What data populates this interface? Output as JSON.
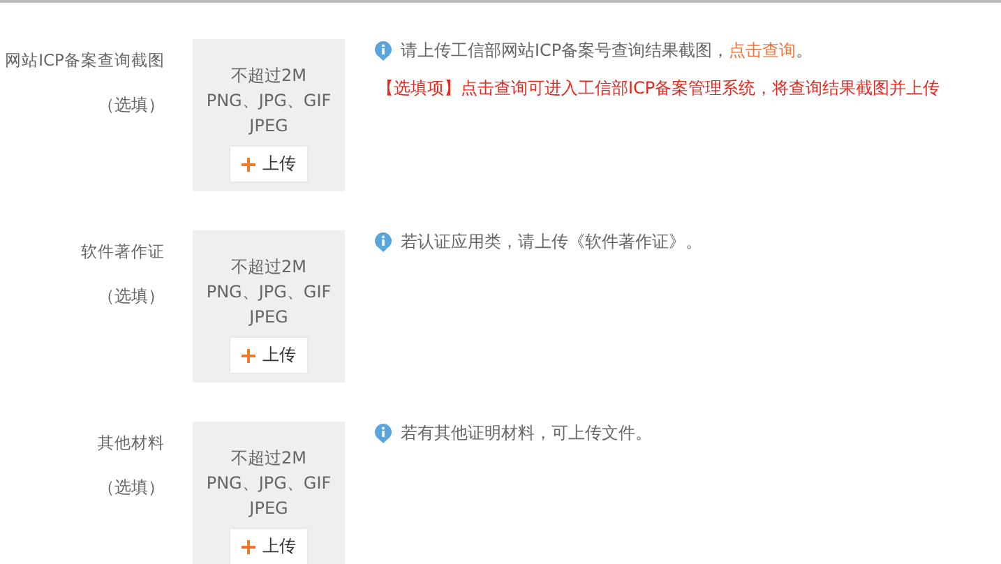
{
  "rows": [
    {
      "label": "网站ICP备案查询截图",
      "optional": "（选填）",
      "limits": [
        "不超过2M",
        "PNG、JPG、GIF",
        "JPEG"
      ],
      "upload": "上传",
      "hint": "请上传工信部网站ICP备案号查询结果截图，",
      "link": "点击查询",
      "suffix": "。",
      "note": "【选填项】点击查询可进入工信部ICP备案管理系统，将查询结果截图并上传"
    },
    {
      "label": "软件著作证",
      "optional": "（选填）",
      "limits": [
        "不超过2M",
        "PNG、JPG、GIF",
        "JPEG"
      ],
      "upload": "上传",
      "hint": "若认证应用类，请上传《软件著作证》。"
    },
    {
      "label": "其他材料",
      "optional": "（选填）",
      "limits": [
        "不超过2M",
        "PNG、JPG、GIF",
        "JPEG"
      ],
      "upload": "上传",
      "hint": "若有其他证明材料，可上传文件。"
    }
  ]
}
